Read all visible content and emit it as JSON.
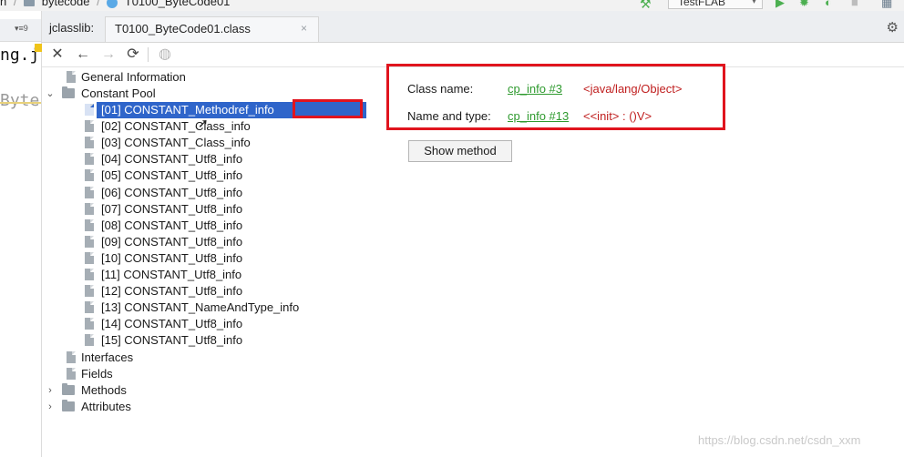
{
  "breadcrumb": {
    "project_fragment": "n",
    "module": "bytecode",
    "class": "T0100_ByteCode01"
  },
  "run_config": {
    "label": "TestFLAB"
  },
  "editor": {
    "code_line1": "ng.j",
    "code_line2": "Byte",
    "tab_controls": "▾≡9"
  },
  "jclasslib": {
    "panel_label": "jclasslib:",
    "file_tab": "T0100_ByteCode01.class",
    "close_glyph": "×"
  },
  "toolbar": {
    "close": "✕",
    "back": "←",
    "forward": "→",
    "refresh": "⟳",
    "browser": "◍"
  },
  "tree": {
    "general": "General Information",
    "constant_pool": "Constant Pool",
    "constants": [
      "[01] CONSTANT_Methodref_info",
      "[02] CONSTANT_Class_info",
      "[03] CONSTANT_Class_info",
      "[04] CONSTANT_Utf8_info",
      "[05] CONSTANT_Utf8_info",
      "[06] CONSTANT_Utf8_info",
      "[07] CONSTANT_Utf8_info",
      "[08] CONSTANT_Utf8_info",
      "[09] CONSTANT_Utf8_info",
      "[10] CONSTANT_Utf8_info",
      "[11] CONSTANT_Utf8_info",
      "[12] CONSTANT_Utf8_info",
      "[13] CONSTANT_NameAndType_info",
      "[14] CONSTANT_Utf8_info",
      "[15] CONSTANT_Utf8_info"
    ],
    "selected_index": 0,
    "interfaces": "Interfaces",
    "fields": "Fields",
    "methods": "Methods",
    "attributes": "Attributes"
  },
  "detail": {
    "class_name_label": "Class name:",
    "class_name_link": "cp_info #3",
    "class_name_value": "<java/lang/Object>",
    "name_type_label": "Name and type:",
    "name_type_link": "cp_info #13",
    "name_type_value": "<<init> : ()V>",
    "show_method": "Show method"
  },
  "watermark": "https://blog.csdn.net/csdn_xxm",
  "colors": {
    "selection": "#2f65ca",
    "highlight_box": "#e0141e",
    "link": "#2e9a2e",
    "value": "#c02020"
  }
}
